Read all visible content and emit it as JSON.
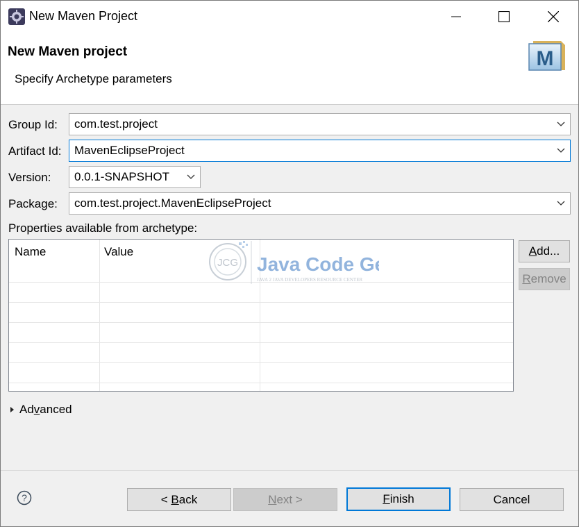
{
  "window": {
    "title": "New Maven Project",
    "icon": "eclipse-gear-icon",
    "controls": [
      "minimize-icon",
      "maximize-icon",
      "close-icon"
    ]
  },
  "header": {
    "title": "New Maven project",
    "subtitle": "Specify Archetype parameters",
    "logo_letter": "M"
  },
  "form": {
    "group_id": {
      "label": "Group Id:",
      "value": "com.test.project"
    },
    "artifact_id": {
      "label": "Artifact Id:",
      "value": "MavenEclipseProject"
    },
    "version": {
      "label": "Version:",
      "value": "0.0.1-SNAPSHOT"
    },
    "package": {
      "label": "Package:",
      "value": "com.test.project.MavenEclipseProject"
    }
  },
  "properties": {
    "label": "Properties available from archetype:",
    "columns": [
      "Name",
      "Value"
    ],
    "rows": [],
    "watermark": {
      "title": "Java Code Geeks",
      "tagline": "JAVA 2 JAVA DEVELOPERS RESOURCE CENTER",
      "badge": "JCG"
    }
  },
  "side_buttons": {
    "add": {
      "before": "",
      "mnemonic": "A",
      "after": "dd..."
    },
    "remove": {
      "before": "",
      "mnemonic": "R",
      "after": "emove"
    }
  },
  "advanced": {
    "before": "Ad",
    "mnemonic": "v",
    "after": "anced"
  },
  "footer": {
    "help_icon": "help-icon",
    "back": {
      "before": "< ",
      "mnemonic": "B",
      "after": "ack"
    },
    "next": {
      "before": "",
      "mnemonic": "N",
      "after": "ext >"
    },
    "finish": {
      "before": "",
      "mnemonic": "F",
      "after": "inish"
    },
    "cancel": {
      "label": "Cancel"
    }
  },
  "colors": {
    "accent": "#0078d7",
    "dialog_bg": "#f0f0f0",
    "disabled_text": "#838383"
  }
}
